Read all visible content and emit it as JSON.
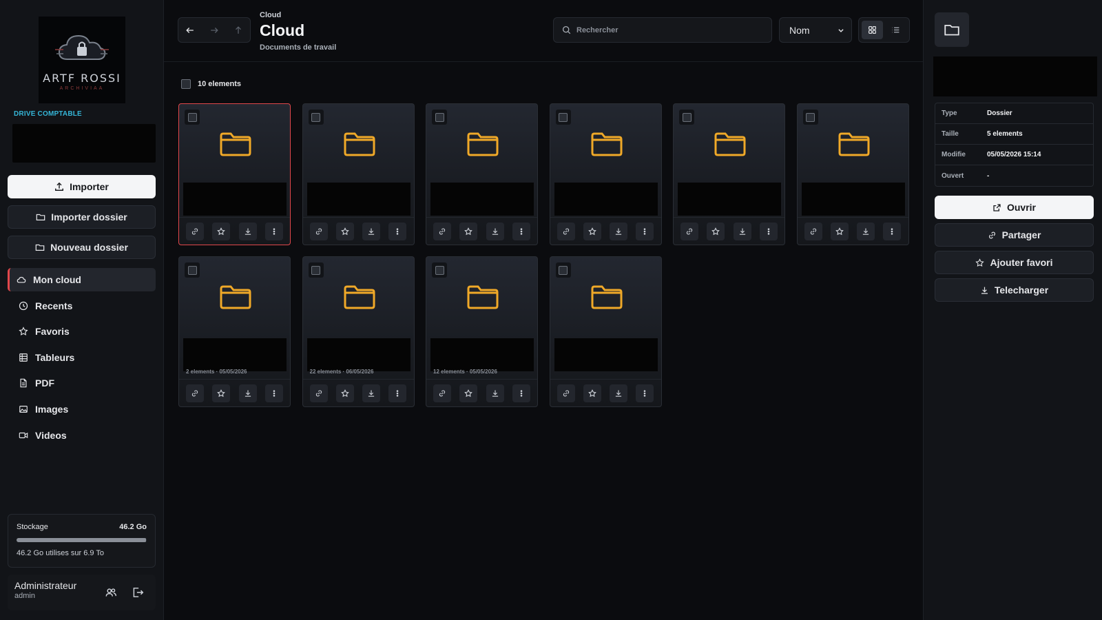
{
  "sidebar": {
    "logo": {
      "text": "ARTF ROSSI",
      "sub": "ARCHIVIAA"
    },
    "drive_label": "DRIVE COMPTABLE",
    "buttons": {
      "import": "Importer",
      "import_folder": "Importer dossier",
      "new_folder": "Nouveau dossier"
    },
    "nav": [
      {
        "label": "Mon cloud",
        "icon": "cloud-icon"
      },
      {
        "label": "Recents",
        "icon": "clock-icon"
      },
      {
        "label": "Favoris",
        "icon": "star-icon"
      },
      {
        "label": "Tableurs",
        "icon": "grid-icon"
      },
      {
        "label": "PDF",
        "icon": "file-icon"
      },
      {
        "label": "Images",
        "icon": "image-icon"
      },
      {
        "label": "Videos",
        "icon": "video-icon"
      }
    ],
    "storage": {
      "label": "Stockage",
      "value": "46.2 Go",
      "note": "46.2 Go utilises sur 6.9 To",
      "used_fraction": 0.995
    },
    "user": {
      "name": "Administrateur",
      "role": "admin"
    }
  },
  "header": {
    "breadcrumb": "Cloud",
    "title": "Cloud",
    "subtitle": "Documents de travail",
    "search_placeholder": "Rechercher",
    "sort_value": "Nom"
  },
  "content": {
    "count_label": "10 elements",
    "items": [
      {
        "meta": ""
      },
      {
        "meta": ""
      },
      {
        "meta": ""
      },
      {
        "meta": ""
      },
      {
        "meta": ""
      },
      {
        "meta": ""
      },
      {
        "meta": "2 elements · 05/05/2026"
      },
      {
        "meta": "22 elements · 06/05/2026"
      },
      {
        "meta": "12 elements · 05/05/2026"
      },
      {
        "meta": ""
      }
    ]
  },
  "details": {
    "rows": [
      {
        "key": "Type",
        "value": "Dossier"
      },
      {
        "key": "Taille",
        "value": "5 elements"
      },
      {
        "key": "Modifie",
        "value": "05/05/2026 15:14"
      },
      {
        "key": "Ouvert",
        "value": "-"
      }
    ],
    "buttons": {
      "open": "Ouvrir",
      "share": "Partager",
      "favorite": "Ajouter favori",
      "download": "Telecharger"
    }
  },
  "colors": {
    "accent": "#e2474b",
    "folder": "#f0a928",
    "drive_label": "#35b6d8"
  }
}
